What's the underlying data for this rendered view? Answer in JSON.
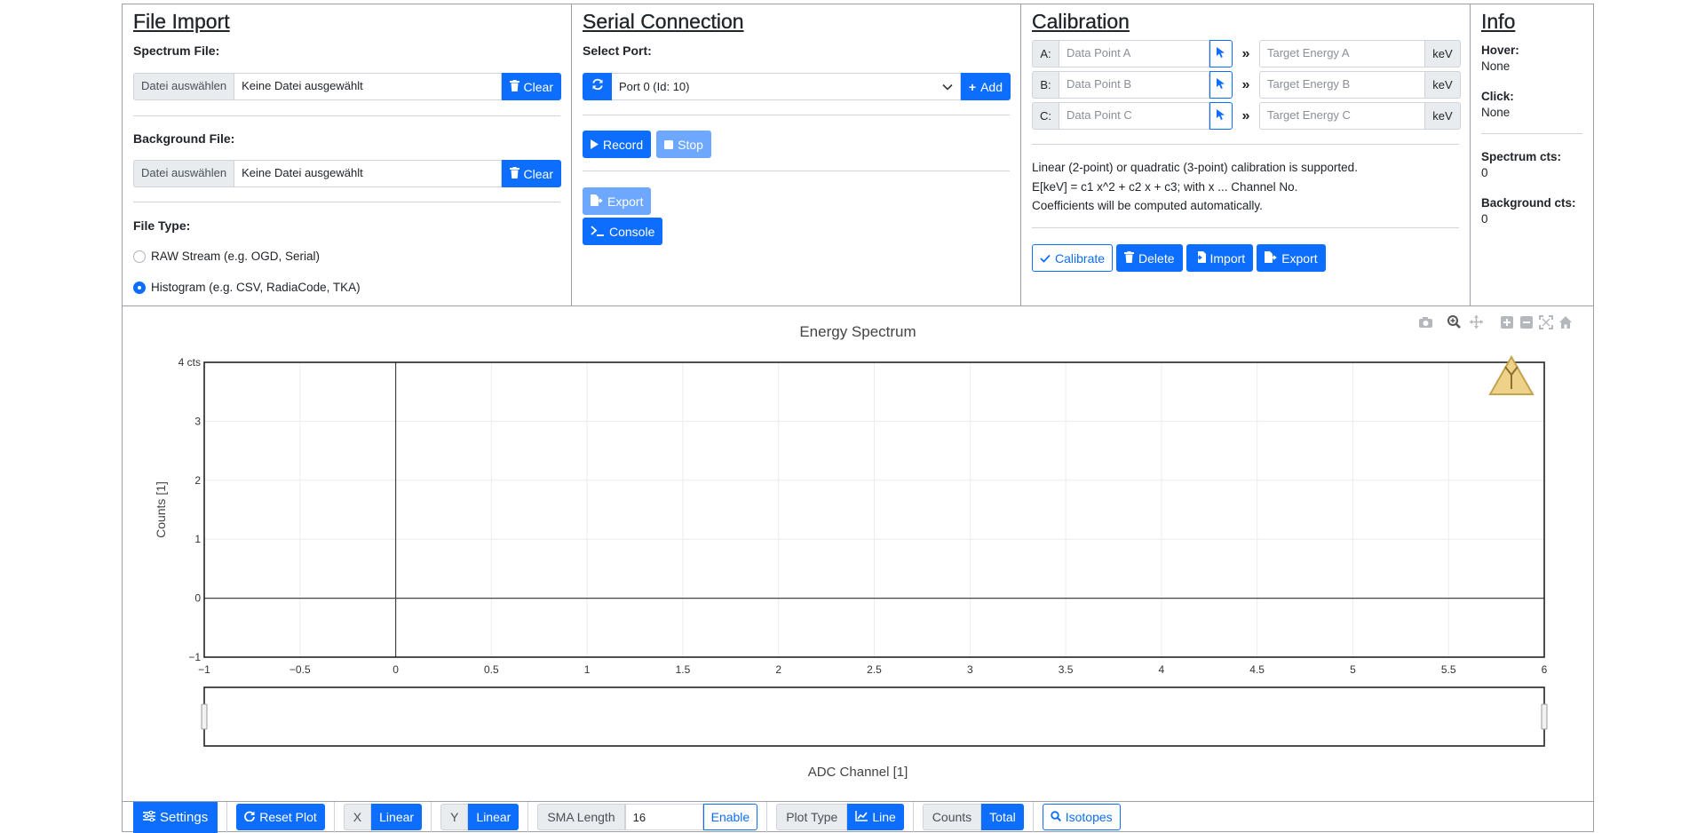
{
  "file_import": {
    "title": "File Import",
    "spectrum_label": "Spectrum File:",
    "background_label": "Background File:",
    "choose_label": "Datei auswählen",
    "no_file_text": "Keine Datei ausgewählt",
    "clear_label": "Clear",
    "file_type_label": "File Type:",
    "file_types": [
      {
        "label": "RAW Stream (e.g. OGD, Serial)",
        "selected": false
      },
      {
        "label": "Histogram (e.g. CSV, RadiaCode, TKA)",
        "selected": true
      }
    ]
  },
  "serial": {
    "title": "Serial Connection",
    "select_port_label": "Select Port:",
    "port_value": "Port 0 (Id: 10)",
    "add_label": "Add",
    "record_label": "Record",
    "stop_label": "Stop",
    "export_label": "Export",
    "console_label": "Console"
  },
  "calibration": {
    "title": "Calibration",
    "rows": [
      {
        "tag": "A:",
        "point_placeholder": "Data Point A",
        "target_placeholder": "Target Energy A",
        "unit": "keV"
      },
      {
        "tag": "B:",
        "point_placeholder": "Data Point B",
        "target_placeholder": "Target Energy B",
        "unit": "keV"
      },
      {
        "tag": "C:",
        "point_placeholder": "Data Point C",
        "target_placeholder": "Target Energy C",
        "unit": "keV"
      }
    ],
    "help_lines": [
      "Linear (2-point) or quadratic (3-point) calibration is supported.",
      "E[keV] = c1 x^2 + c2 x + c3; with x ... Channel No.",
      "Coefficients will be computed automatically."
    ],
    "calibrate_label": "Calibrate",
    "delete_label": "Delete",
    "import_label": "Import",
    "export_label": "Export"
  },
  "info": {
    "title": "Info",
    "hover_label": "Hover:",
    "hover_value": "None",
    "click_label": "Click:",
    "click_value": "None",
    "spectrum_cts_label": "Spectrum cts:",
    "spectrum_cts_value": "0",
    "background_cts_label": "Background cts:",
    "background_cts_value": "0"
  },
  "chart_data": {
    "type": "line",
    "title": "Energy Spectrum",
    "xlabel": "ADC Channel [1]",
    "ylabel": "Counts [1]",
    "xlim": [
      -1,
      6
    ],
    "ylim": [
      -1,
      4
    ],
    "x_ticks": [
      -1,
      -0.5,
      0,
      0.5,
      1,
      1.5,
      2,
      2.5,
      3,
      3.5,
      4,
      4.5,
      5,
      5.5,
      6
    ],
    "x_tick_labels": [
      "−1",
      "−0.5",
      "0",
      "0.5",
      "1",
      "1.5",
      "2",
      "2.5",
      "3",
      "3.5",
      "4",
      "4.5",
      "5",
      "5.5",
      "6"
    ],
    "y_ticks": [
      -1,
      0,
      1,
      2,
      3,
      4
    ],
    "y_tick_labels": [
      "−1",
      "0",
      "1",
      "2",
      "3",
      "4 cts"
    ],
    "grid": true,
    "series": [],
    "range_slider": true
  },
  "bottom_bar": {
    "settings_label": "Settings",
    "reset_plot_label": "Reset Plot",
    "x_label": "X",
    "x_value": "Linear",
    "y_label": "Y",
    "y_value": "Linear",
    "sma_label": "SMA Length",
    "sma_value": "16",
    "sma_enable_label": "Enable",
    "plot_type_label": "Plot Type",
    "plot_type_value": "Line",
    "counts_label": "Counts",
    "counts_value": "Total",
    "isotopes_label": "Isotopes"
  },
  "colors": {
    "primary": "#0d6efd",
    "primary_light": "#6ea8fe",
    "warning_icon": "#e8c55a"
  }
}
